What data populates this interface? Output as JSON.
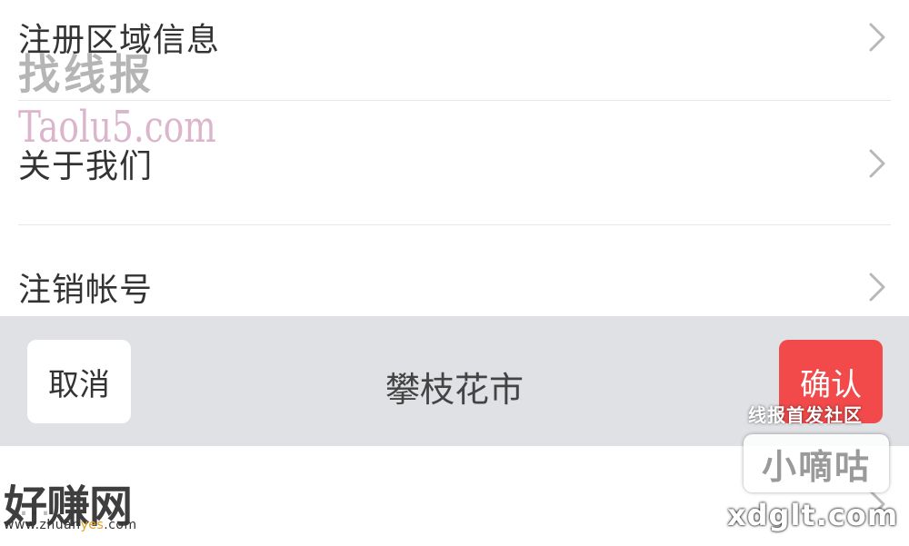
{
  "settings": {
    "items": [
      {
        "label": "注册区域信息"
      },
      {
        "label": "关于我们"
      },
      {
        "label": "注销帐号"
      }
    ],
    "partial_item": {
      "label": "…"
    }
  },
  "picker": {
    "cancel_label": "取消",
    "selected_value": "攀枝花市",
    "confirm_label": "确认"
  },
  "icons": {
    "row_chevron": "chevron-right-icon"
  },
  "watermarks": {
    "top_left_cn": "找线报",
    "top_left_en": "Taolu5.com",
    "bottom_right_tag": "线报首发社区",
    "bottom_right_box": "小嘀咕",
    "bottom_right_url": "xdglt.com",
    "bottom_left_cn": "好赚网",
    "bottom_left_url_prefix": "www.zhuan",
    "bottom_left_url_accent": "yes",
    "bottom_left_url_suffix": ".com"
  },
  "colors": {
    "confirm_bg": "#f24a4a",
    "picker_bar_bg": "#dfe1e5",
    "text_primary": "#333333"
  }
}
